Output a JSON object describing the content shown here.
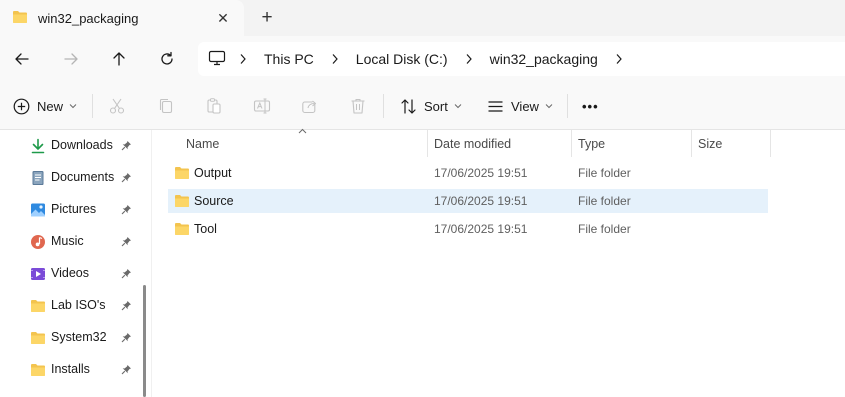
{
  "tab": {
    "title": "win32_packaging",
    "close_glyph": "✕",
    "new_glyph": "+"
  },
  "breadcrumbs": [
    "This PC",
    "Local Disk (C:)",
    "win32_packaging"
  ],
  "commands": {
    "new": "New",
    "sort": "Sort",
    "view": "View",
    "more": "•••"
  },
  "columns": {
    "name": "Name",
    "date": "Date modified",
    "type": "Type",
    "size": "Size"
  },
  "sidebar": {
    "items": [
      {
        "label": "Downloads",
        "icon": "download-icon"
      },
      {
        "label": "Documents",
        "icon": "documents-icon"
      },
      {
        "label": "Pictures",
        "icon": "pictures-icon"
      },
      {
        "label": "Music",
        "icon": "music-icon"
      },
      {
        "label": "Videos",
        "icon": "videos-icon"
      },
      {
        "label": "Lab ISO's",
        "icon": "folder-icon"
      },
      {
        "label": "System32",
        "icon": "folder-icon"
      },
      {
        "label": "Installs",
        "icon": "folder-icon"
      }
    ]
  },
  "files": [
    {
      "name": "Output",
      "date": "17/06/2025 19:51",
      "type": "File folder",
      "size": ""
    },
    {
      "name": "Source",
      "date": "17/06/2025 19:51",
      "type": "File folder",
      "size": "",
      "selected": true
    },
    {
      "name": "Tool",
      "date": "17/06/2025 19:51",
      "type": "File folder",
      "size": ""
    }
  ],
  "colors": {
    "accent": "#0067c0",
    "folder": "#f3c44f",
    "selection": "#e5f1fb"
  }
}
